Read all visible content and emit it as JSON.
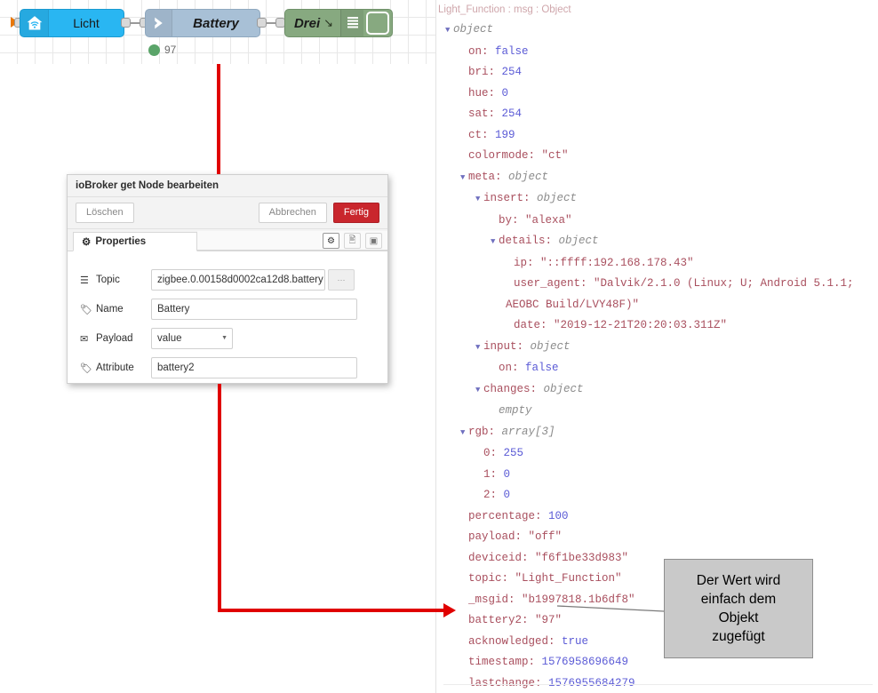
{
  "colors": {
    "node_ioget": "#29b6f2",
    "node_change": "#a8c0d6",
    "node_debug": "#87a980",
    "status_dot": "#5aa469",
    "annotation_red": "#e00000",
    "primary_button": "#c9262d",
    "callout_bg": "#c9c9c9"
  },
  "flow": {
    "nodes": [
      {
        "id": "ioget",
        "label": "Licht",
        "icon": "home-wifi-icon"
      },
      {
        "id": "change",
        "label": "Battery",
        "icon": "arrow-right-icon"
      },
      {
        "id": "debug",
        "label": "Drei",
        "icon": "debug-arrow-icon"
      }
    ],
    "status": {
      "text": "97",
      "dot": "green"
    }
  },
  "dialog": {
    "title": "ioBroker get Node bearbeiten",
    "buttons": {
      "delete": "Löschen",
      "cancel": "Abbrechen",
      "done": "Fertig"
    },
    "tab": {
      "label": "Properties",
      "icon": "gear-icon"
    },
    "tool_icons": [
      "gear-icon",
      "document-icon",
      "appearance-icon"
    ],
    "fields": [
      {
        "key": "topic",
        "label": "Topic",
        "icon": "list-icon",
        "value": "zigbee.0.00158d0002ca12d8.battery",
        "type": "text"
      },
      {
        "key": "name",
        "label": "Name",
        "icon": "tag-icon",
        "value": "Battery",
        "type": "text"
      },
      {
        "key": "payload",
        "label": "Payload",
        "icon": "envelope-icon",
        "value": "value",
        "type": "select"
      },
      {
        "key": "attribute",
        "label": "Attribute",
        "icon": "tag-icon",
        "value": "battery2",
        "type": "text"
      }
    ]
  },
  "debug": {
    "header": "Light_Function : msg : Object",
    "lines": [
      {
        "indent": 0,
        "tri": true,
        "key": "object",
        "keyClass": "t"
      },
      {
        "indent": 1,
        "key": "on",
        "value": "false",
        "valueClass": "v-bool"
      },
      {
        "indent": 1,
        "key": "bri",
        "value": "254",
        "valueClass": "v-num"
      },
      {
        "indent": 1,
        "key": "hue",
        "value": "0",
        "valueClass": "v-num"
      },
      {
        "indent": 1,
        "key": "sat",
        "value": "254",
        "valueClass": "v-num"
      },
      {
        "indent": 1,
        "key": "ct",
        "value": "199",
        "valueClass": "v-num"
      },
      {
        "indent": 1,
        "key": "colormode",
        "value": "\"ct\"",
        "valueClass": "v-str"
      },
      {
        "indent": 1,
        "tri": true,
        "key": "meta",
        "value": "object",
        "valueClass": "t"
      },
      {
        "indent": 2,
        "tri": true,
        "key": "insert",
        "value": "object",
        "valueClass": "t"
      },
      {
        "indent": 3,
        "key": "by",
        "value": "\"alexa\"",
        "valueClass": "v-str"
      },
      {
        "indent": 3,
        "tri": true,
        "key": "details",
        "value": "object",
        "valueClass": "t"
      },
      {
        "indent": 4,
        "key": "ip",
        "value": "\"::ffff:192.168.178.43\"",
        "valueClass": "v-str"
      },
      {
        "indent": 4,
        "key": "user_agent",
        "value": "\"Dalvik/2.1.0 (Linux; U; Android 5.1.1; AEOBC Build/LVY48F)\"",
        "valueClass": "v-str"
      },
      {
        "indent": 4,
        "key": "date",
        "value": "\"2019-12-21T20:20:03.311Z\"",
        "valueClass": "v-str"
      },
      {
        "indent": 2,
        "tri": true,
        "key": "input",
        "value": "object",
        "valueClass": "t"
      },
      {
        "indent": 3,
        "key": "on",
        "value": "false",
        "valueClass": "v-bool"
      },
      {
        "indent": 2,
        "tri": true,
        "key": "changes",
        "value": "object",
        "valueClass": "t"
      },
      {
        "indent": 3,
        "key": "",
        "value": "empty",
        "valueClass": "v-empty"
      },
      {
        "indent": 1,
        "tri": true,
        "key": "rgb",
        "value": "array[3]",
        "valueClass": "t"
      },
      {
        "indent": 2,
        "key": "0",
        "value": "255",
        "valueClass": "v-num"
      },
      {
        "indent": 2,
        "key": "1",
        "value": "0",
        "valueClass": "v-num"
      },
      {
        "indent": 2,
        "key": "2",
        "value": "0",
        "valueClass": "v-num"
      },
      {
        "indent": 1,
        "key": "percentage",
        "value": "100",
        "valueClass": "v-num"
      },
      {
        "indent": 1,
        "key": "payload",
        "value": "\"off\"",
        "valueClass": "v-str"
      },
      {
        "indent": 1,
        "key": "deviceid",
        "value": "\"f6f1be33d983\"",
        "valueClass": "v-str"
      },
      {
        "indent": 1,
        "key": "topic",
        "value": "\"Light_Function\"",
        "valueClass": "v-str"
      },
      {
        "indent": 1,
        "key": "_msgid",
        "value": "\"b1997818.1b6df8\"",
        "valueClass": "v-str"
      },
      {
        "indent": 1,
        "key": "battery2",
        "value": "\"97\"",
        "valueClass": "v-str"
      },
      {
        "indent": 1,
        "key": "acknowledged",
        "value": "true",
        "valueClass": "v-bool"
      },
      {
        "indent": 1,
        "key": "timestamp",
        "value": "1576958696649",
        "valueClass": "v-num"
      },
      {
        "indent": 1,
        "key": "lastchange",
        "value": "1576955684279",
        "valueClass": "v-num"
      }
    ]
  },
  "annotation": {
    "callout_lines": [
      "Der Wert wird",
      "einfach dem",
      "Objekt",
      "zugefügt"
    ]
  }
}
